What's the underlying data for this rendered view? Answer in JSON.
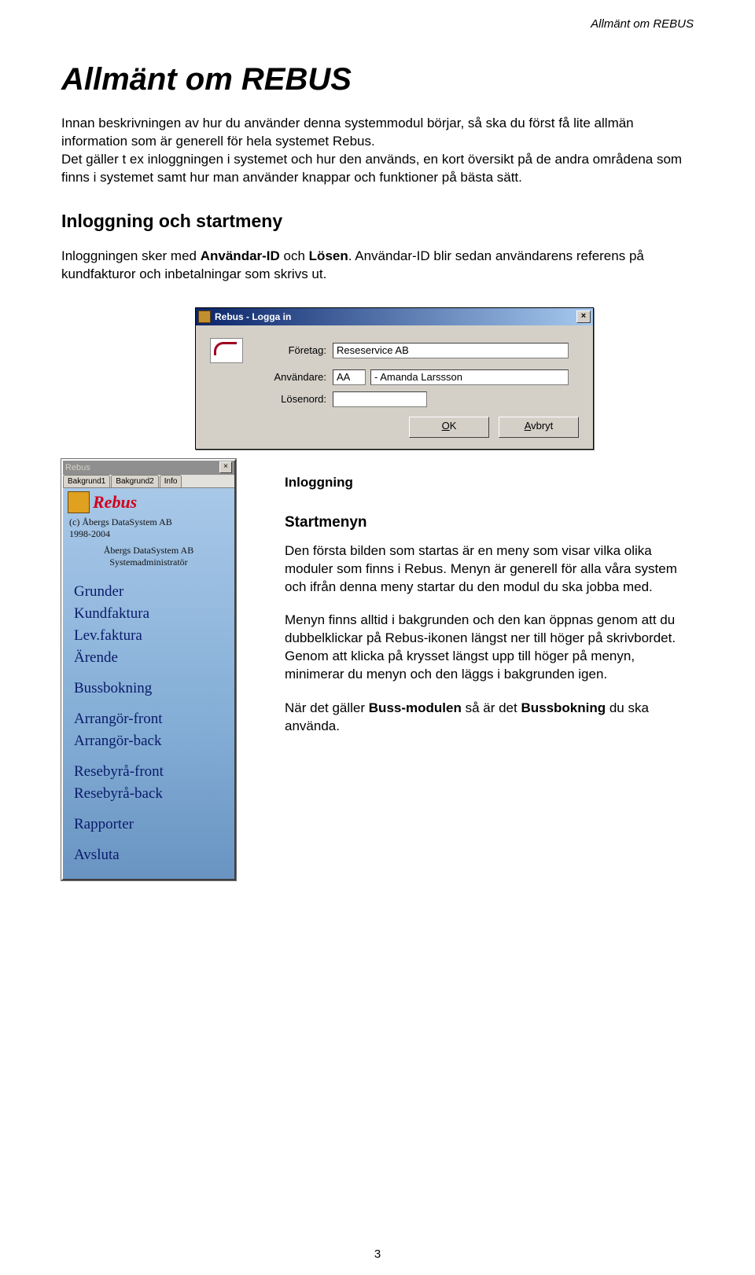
{
  "page": {
    "header": "Allmänt om REBUS",
    "title": "Allmänt om REBUS",
    "intro": "Innan beskrivningen av hur du använder denna systemmodul börjar, så ska du först få lite allmän information som är generell för hela systemet Rebus.\nDet gäller t ex inloggningen i systemet och hur den används, en kort översikt på de andra områdena som finns i systemet samt hur man använder knappar och funktioner på bästa sätt.",
    "h2": "Inloggning och startmeny",
    "login_text_1": "Inloggningen sker med ",
    "login_text_b1": "Användar-ID",
    "login_text_2": " och ",
    "login_text_b2": "Lösen",
    "login_text_3": ". Användar-ID blir sedan användarens referens på kundfakturor och inbetalningar som skrivs ut.",
    "caption_inloggning": "Inloggning",
    "h3": "Startmenyn",
    "p1": "Den första bilden som startas är en meny som visar vilka olika moduler som finns i Rebus. Menyn är generell för alla våra system och ifrån denna meny startar du den modul du ska jobba med.",
    "p2": "Menyn finns alltid i bakgrunden och den kan öppnas genom att du dubbelklickar på Rebus-ikonen längst ner till höger på skrivbordet. Genom att klicka på krysset längst upp till höger på menyn, minimerar du menyn och den läggs i bakgrunden igen.",
    "p3a": "När det gäller ",
    "p3b1": "Buss-modulen",
    "p3b": " så är det ",
    "p3b2": "Bussbokning",
    "p3c": " du ska använda.",
    "page_number": "3"
  },
  "dialog": {
    "title": "Rebus - Logga in",
    "close_x": "×",
    "labels": {
      "foretag": "Företag:",
      "anvandare": "Användare:",
      "losenord": "Lösenord:"
    },
    "values": {
      "foretag": "Reseservice AB",
      "anvandare_code": "AA",
      "anvandare_name": "- Amanda Larssson",
      "losenord": ""
    },
    "buttons": {
      "ok": "OK",
      "avbryt": "Avbryt"
    },
    "underline": {
      "ok": "O",
      "avbryt": "A"
    }
  },
  "startmenu": {
    "title": "Rebus",
    "close_x": "×",
    "tabs": [
      "Bakgrund1",
      "Bakgrund2",
      "Info"
    ],
    "logo_text": "Rebus",
    "copyright": "(c) Åbergs DataSystem AB\n1998-2004",
    "admin_text": "Åbergs DataSystem AB\nSystemadministratör",
    "items": [
      {
        "label": "Grunder",
        "spaced": false
      },
      {
        "label": "Kundfaktura",
        "spaced": false
      },
      {
        "label": "Lev.faktura",
        "spaced": false
      },
      {
        "label": "Ärende",
        "spaced": false
      },
      {
        "label": "Bussbokning",
        "spaced": true
      },
      {
        "label": "Arrangör-front",
        "spaced": true
      },
      {
        "label": "Arrangör-back",
        "spaced": false
      },
      {
        "label": "Resebyrå-front",
        "spaced": true
      },
      {
        "label": "Resebyrå-back",
        "spaced": false
      },
      {
        "label": "Rapporter",
        "spaced": true
      },
      {
        "label": "Avsluta",
        "spaced": true
      }
    ]
  }
}
